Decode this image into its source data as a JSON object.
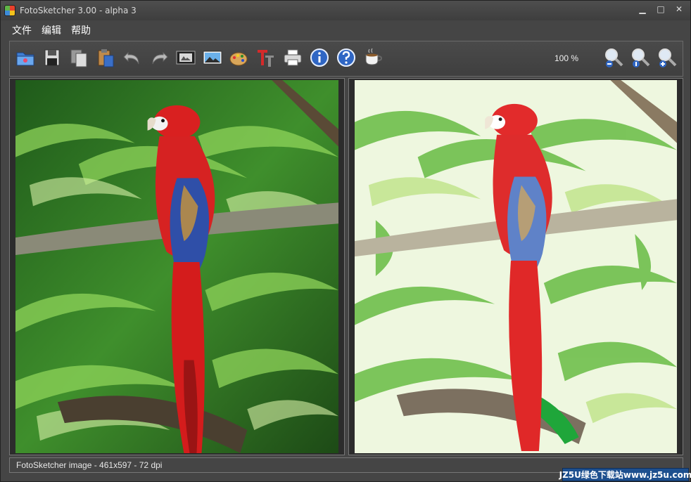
{
  "window": {
    "title": "FotoSketcher 3.00 - alpha 3",
    "controls": {
      "minimize": "▁",
      "maximize": "□",
      "close": "✕"
    }
  },
  "menu": {
    "items": [
      {
        "label": "文件"
      },
      {
        "label": "编辑"
      },
      {
        "label": "帮助"
      }
    ]
  },
  "toolbar": {
    "zoom_level": "100 %",
    "buttons": [
      {
        "icon": "open-folder-icon"
      },
      {
        "icon": "save-disk-icon"
      },
      {
        "icon": "copy-icon"
      },
      {
        "icon": "paste-icon"
      },
      {
        "icon": "undo-icon"
      },
      {
        "icon": "redo-icon"
      },
      {
        "icon": "film-strip-icon"
      },
      {
        "icon": "picture-icon"
      },
      {
        "icon": "paint-palette-icon"
      },
      {
        "icon": "text-tool-icon"
      },
      {
        "icon": "printer-icon"
      },
      {
        "icon": "info-icon"
      },
      {
        "icon": "help-icon"
      },
      {
        "icon": "coffee-cup-icon"
      },
      {
        "icon": "zoom-out-icon"
      },
      {
        "icon": "zoom-actual-icon"
      },
      {
        "icon": "zoom-in-icon"
      }
    ]
  },
  "panels": {
    "left": {
      "content": "original-photo"
    },
    "right": {
      "content": "sketched-photo"
    }
  },
  "status": {
    "text": "FotoSketcher image - 461x597 - 72 dpi"
  },
  "watermark": {
    "text": "JZ5U绿色下载站www.jz5u.com"
  },
  "colors": {
    "background": "#454545",
    "toolbar_border": "#6a6a6a",
    "watermark_bg": "#1d4f8e",
    "parrot_red": "#d92020",
    "parrot_blue": "#2f4fa8",
    "foliage_green": "#3a8a2c"
  }
}
